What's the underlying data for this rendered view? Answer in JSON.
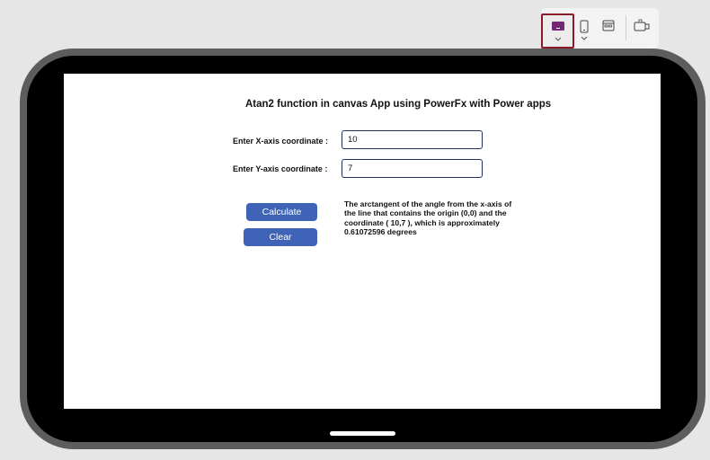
{
  "toolbar": {
    "buttons": [
      {
        "name": "tablet-layout",
        "icon": "tablet-icon",
        "selected": true
      },
      {
        "name": "phone-layout",
        "icon": "phone-icon",
        "selected": false
      },
      {
        "name": "web-layout",
        "icon": "web-layout-icon",
        "selected": false
      },
      {
        "name": "custom-size",
        "icon": "custom-size-icon",
        "selected": false
      }
    ],
    "selected_border_color": "#8b1a2a",
    "accent_color": "#742774"
  },
  "app": {
    "title": "Atan2 function in canvas App using PowerFx with Power apps",
    "title_mark": ".",
    "x_label": "Enter X-axis coordinate :",
    "x_value": "10",
    "y_label": "Enter Y-axis coordinate :",
    "y_value": "7",
    "calculate_label": "Calculate",
    "clear_label": "Clear",
    "result": "The arctangent of the angle from the x-axis of the line that contains the origin (0,0) and the coordinate ( 10,7 ), which is approximately 0.61072596 degrees",
    "button_color": "#3f63b6",
    "input_border_color": "#23305e"
  }
}
